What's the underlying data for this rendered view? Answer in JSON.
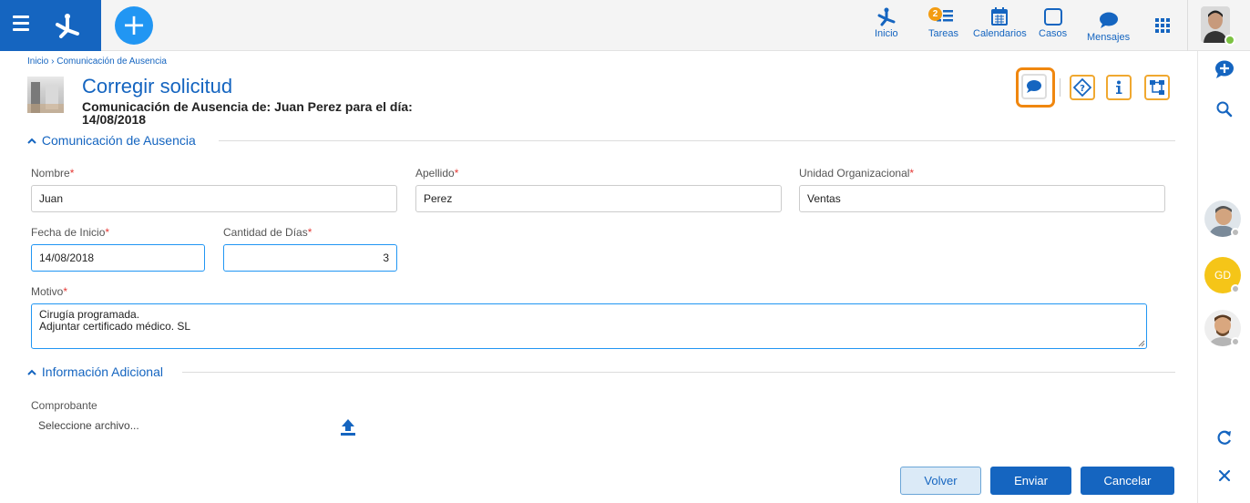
{
  "topbar": {
    "nav": [
      {
        "id": "inicio",
        "label": "Inicio",
        "icon": "process-icon"
      },
      {
        "id": "tareas",
        "label": "Tareas",
        "icon": "tasks-icon",
        "badge": "2"
      },
      {
        "id": "calendarios",
        "label": "Calendarios",
        "icon": "calendar-icon"
      },
      {
        "id": "casos",
        "label": "Casos",
        "icon": "cases-icon"
      },
      {
        "id": "mensajes",
        "label": "Mensajes",
        "icon": "chat-icon"
      }
    ],
    "add_label": "+"
  },
  "breadcrumb": {
    "home": "Inicio",
    "separator": "›",
    "current": "Comunicación de Ausencia"
  },
  "header": {
    "title": "Corregir solicitud",
    "subtitle_line1": "Comunicación de Ausencia de: Juan Perez para el día:",
    "subtitle_line2": "14/08/2018"
  },
  "sections": {
    "main": "Comunicación de Ausencia",
    "additional": "Información Adicional"
  },
  "fields": {
    "nombre": {
      "label": "Nombre",
      "value": "Juan"
    },
    "apellido": {
      "label": "Apellido",
      "value": "Perez"
    },
    "unidad": {
      "label": "Unidad Organizacional",
      "value": "Ventas"
    },
    "fecha": {
      "label": "Fecha de Inicio",
      "value": "14/08/2018"
    },
    "cantidad": {
      "label": "Cantidad de Días",
      "value": "3"
    },
    "motivo": {
      "label": "Motivo",
      "value": "Cirugía programada.\nAdjuntar certificado médico. SL"
    },
    "comprobante": {
      "label": "Comprobante",
      "value": "Seleccione archivo..."
    },
    "required_mark": "*"
  },
  "buttons": {
    "volver": "Volver",
    "enviar": "Enviar",
    "cancelar": "Cancelar"
  },
  "sidebar": {
    "gd_initials": "GD"
  },
  "colors": {
    "brand": "#1565c0",
    "accent": "#2196f3",
    "highlight": "#f0870f",
    "required": "#e53935",
    "online": "#7cc242"
  }
}
